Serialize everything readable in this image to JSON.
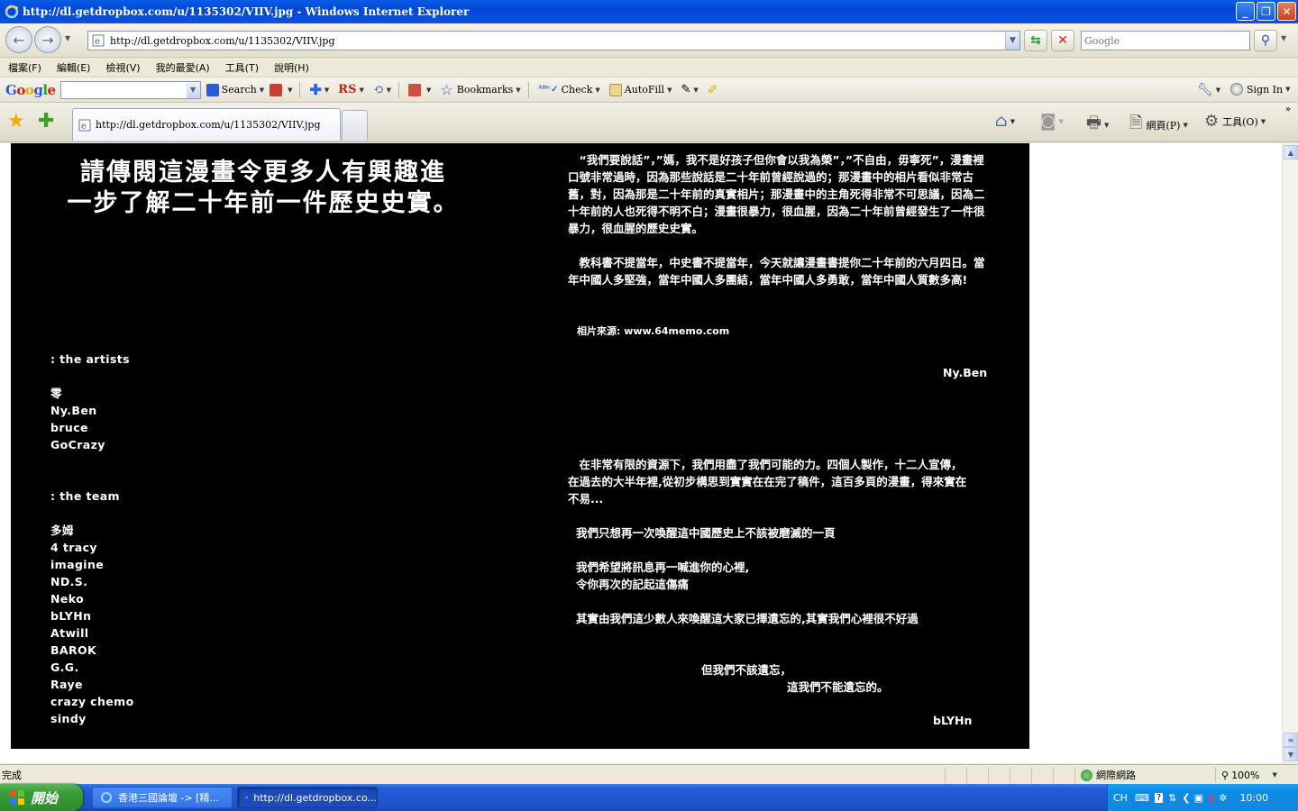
{
  "window": {
    "title": "http://dl.getdropbox.com/u/1135302/VIIV.jpg - Windows Internet Explorer"
  },
  "address": {
    "url": "http://dl.getdropbox.com/u/1135302/VIIV.jpg",
    "search_placeholder": "Google"
  },
  "menu": [
    "檔案(F)",
    "編輯(E)",
    "檢視(V)",
    "我的最愛(A)",
    "工具(T)",
    "說明(H)"
  ],
  "google_toolbar": {
    "logo": "Google",
    "search_label": "Search",
    "rs_label": "RS",
    "bookmarks_label": "Bookmarks",
    "check_label": "Check",
    "autofill_label": "AutoFill",
    "signin_label": "Sign In"
  },
  "tab": {
    "label": "http://dl.getdropbox.com/u/1135302/VIIV.jpg"
  },
  "commands": {
    "page_label": "網頁(P)",
    "tools_label": "工具(O)"
  },
  "image": {
    "heading_line1": "請傳閱這漫畫令更多人有興趣進",
    "heading_line2": "一步了解二十年前一件歷史史實。",
    "artists_heading": ": the  artists",
    "artists": [
      "零",
      "Ny.Ben",
      "bruce",
      "GoCrazy"
    ],
    "team_heading": ": the  team",
    "team": [
      "多姆",
      "4  tracy",
      "imagine",
      "ND.S.",
      "Neko",
      "bLYHn",
      "Atwill",
      "BAROK",
      "G.G.",
      "Raye",
      "crazy  chemo",
      "sindy"
    ],
    "para1": "　“我們要說話”，”媽，我不是好孩子但你會以我為榮”，”不自由，毋寧死”，漫畫裡口號非常過時，因為那些說話是二十年前曾經說過的；那漫畫中的相片看似非常古舊，對，因為那是二十年前的真實相片；那漫畫中的主角死得非常不可思議，因為二十年前的人也死得不明不白；漫畫很暴力，很血腥，因為二十年前曾經發生了一件很暴力，很血腥的歷史史實。",
    "para2": "　教科書不提當年，中史書不提當年，今天就讓漫畫書提你二十年前的六月四日。當年中國人多堅強，當年中國人多團結，當年中國人多勇敢，當年中國人質數多高!",
    "photo_source": "相片來源: www.64memo.com",
    "sign1": "Ny.Ben",
    "para3": "　在非常有限的資源下，我們用盡了我們可能的力。四個人製作，十二人宣傳，在過去的大半年裡,從初步構思到實實在在完了稿件，這百多頁的漫畫，得來實在不易...",
    "para4": "我們只想再一次喚醒這中國歷史上不該被磨滅的一頁",
    "para5_line1": "我們希望將訊息再一喊進你的心裡,",
    "para5_line2": "令你再次的記起這傷痛",
    "para6": "其實由我們這少數人來喚醒這大家已擇遺忘的,其實我們心裡很不好過",
    "para7_line1": "但我們不該遺忘，",
    "para7_line2": "這我們不能遺忘的。",
    "sign2": "bLYHn"
  },
  "status": {
    "text": "完成",
    "zone": "網際網路",
    "zoom": "100%"
  },
  "taskbar": {
    "start_label": "開始",
    "task1": "香港三國論壇 -> [精...",
    "task2": "http://dl.getdropbox.co...",
    "lang": "CH",
    "clock": "10:00"
  }
}
